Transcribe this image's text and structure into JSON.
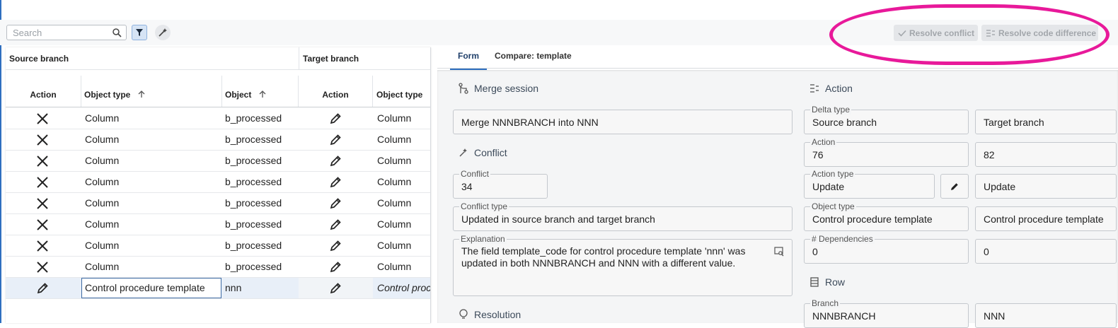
{
  "toolbar": {
    "search_placeholder": "Search",
    "resolve_conflict_label": "Resolve conflict",
    "resolve_code_difference_label": "Resolve code difference"
  },
  "grid": {
    "group_source": "Source branch",
    "group_target": "Target branch",
    "col_action": "Action",
    "col_object_type": "Object type",
    "col_object": "Object",
    "col_tgt_action": "Action",
    "col_tgt_object_type": "Object type",
    "rows": [
      {
        "src_action_icon": "close-icon",
        "object_type": "Column",
        "object": "b_processed",
        "tgt_action_icon": "pencil-icon",
        "tgt_object_type": "Column"
      },
      {
        "src_action_icon": "close-icon",
        "object_type": "Column",
        "object": "b_processed",
        "tgt_action_icon": "pencil-icon",
        "tgt_object_type": "Column"
      },
      {
        "src_action_icon": "close-icon",
        "object_type": "Column",
        "object": "b_processed",
        "tgt_action_icon": "pencil-icon",
        "tgt_object_type": "Column"
      },
      {
        "src_action_icon": "close-icon",
        "object_type": "Column",
        "object": "b_processed",
        "tgt_action_icon": "pencil-icon",
        "tgt_object_type": "Column"
      },
      {
        "src_action_icon": "close-icon",
        "object_type": "Column",
        "object": "b_processed",
        "tgt_action_icon": "pencil-icon",
        "tgt_object_type": "Column"
      },
      {
        "src_action_icon": "close-icon",
        "object_type": "Column",
        "object": "b_processed",
        "tgt_action_icon": "pencil-icon",
        "tgt_object_type": "Column"
      },
      {
        "src_action_icon": "close-icon",
        "object_type": "Column",
        "object": "b_processed",
        "tgt_action_icon": "pencil-icon",
        "tgt_object_type": "Column"
      },
      {
        "src_action_icon": "close-icon",
        "object_type": "Column",
        "object": "b_processed",
        "tgt_action_icon": "pencil-icon",
        "tgt_object_type": "Column"
      },
      {
        "src_action_icon": "pencil-icon",
        "object_type": "Control procedure template",
        "object": "nnn",
        "tgt_action_icon": "pencil-icon",
        "tgt_object_type": "Control proc"
      }
    ]
  },
  "tabs": [
    "Form",
    "Compare: template"
  ],
  "form": {
    "merge_session_title": "Merge session",
    "merge_session_value": "Merge NNNBRANCH into NNN",
    "conflict_title": "Conflict",
    "conflict_label": "Conflict",
    "conflict_value": "34",
    "conflict_type_label": "Conflict type",
    "conflict_type_value": "Updated in source branch and target branch",
    "explanation_label": "Explanation",
    "explanation_value": "The field template_code for control procedure template 'nnn' was updated in both NNNBRANCH and NNN with a different value.",
    "resolution_title": "Resolution",
    "action_title": "Action",
    "delta_type_label": "Delta type",
    "delta_type_source": "Source branch",
    "delta_type_target": "Target branch",
    "action_label": "Action",
    "action_source": "76",
    "action_target": "82",
    "action_type_label": "Action type",
    "action_type_source": "Update",
    "action_type_target": "Update",
    "object_type_label": "Object type",
    "object_type_source": "Control procedure template",
    "object_type_target": "Control procedure template",
    "dependencies_label": "# Dependencies",
    "dependencies_source": "0",
    "dependencies_target": "0",
    "row_title": "Row",
    "branch_label": "Branch",
    "branch_source": "NNNBRANCH",
    "branch_target": "NNN"
  },
  "colors": {
    "highlight": "#e8199a",
    "accent": "#2f6fbf"
  }
}
